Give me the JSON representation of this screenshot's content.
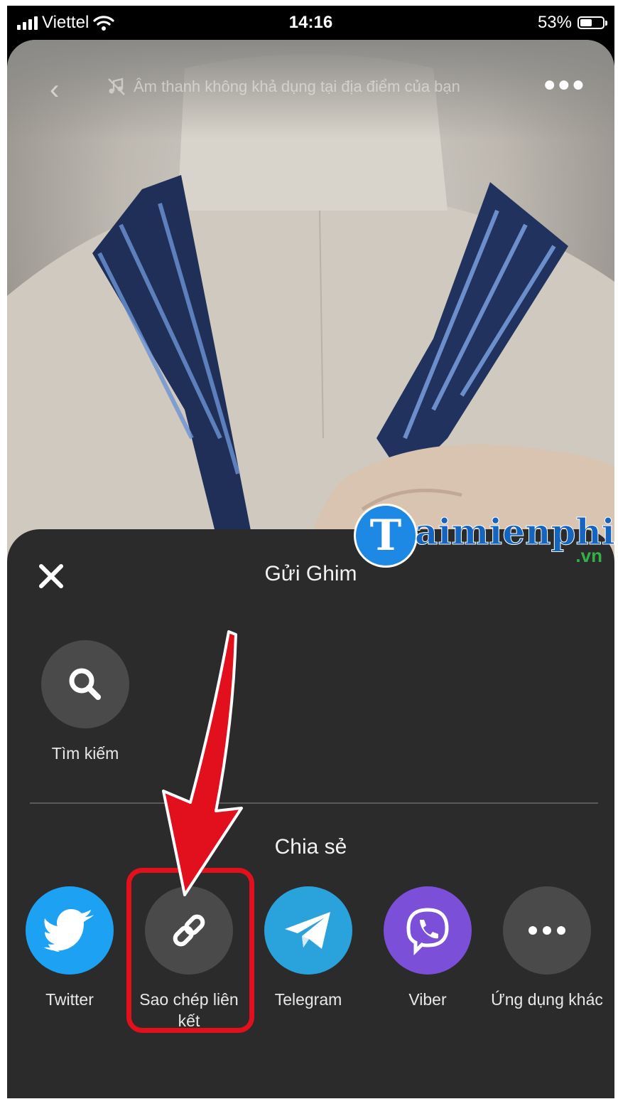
{
  "status_bar": {
    "carrier": "Viettel",
    "time": "14:16",
    "battery_text": "53%",
    "battery_level": 0.53
  },
  "video": {
    "notice": "Âm thanh không khả dụng tại địa điểm của bạn"
  },
  "sheet": {
    "title": "Gửi Ghim",
    "search_label": "Tìm kiếm",
    "share_title": "Chia sẻ",
    "share_items": [
      {
        "label": "Twitter",
        "icon": "twitter-bird-icon",
        "color": "#1da1f2"
      },
      {
        "label": "Sao chép liên kết",
        "icon": "link-icon",
        "color": "#4a4a4a"
      },
      {
        "label": "Telegram",
        "icon": "paper-plane-icon",
        "color": "#2aa3dc"
      },
      {
        "label": "Viber",
        "icon": "phone-bubble-icon",
        "color": "#7b4fd8"
      },
      {
        "label": "Ứng dụng khác",
        "icon": "more-dots-icon",
        "color": "#4a4a4a"
      }
    ]
  },
  "annotation": {
    "highlight_color": "#e1101c"
  },
  "watermark": {
    "text": "aimienphi",
    "tld": ".vn"
  }
}
